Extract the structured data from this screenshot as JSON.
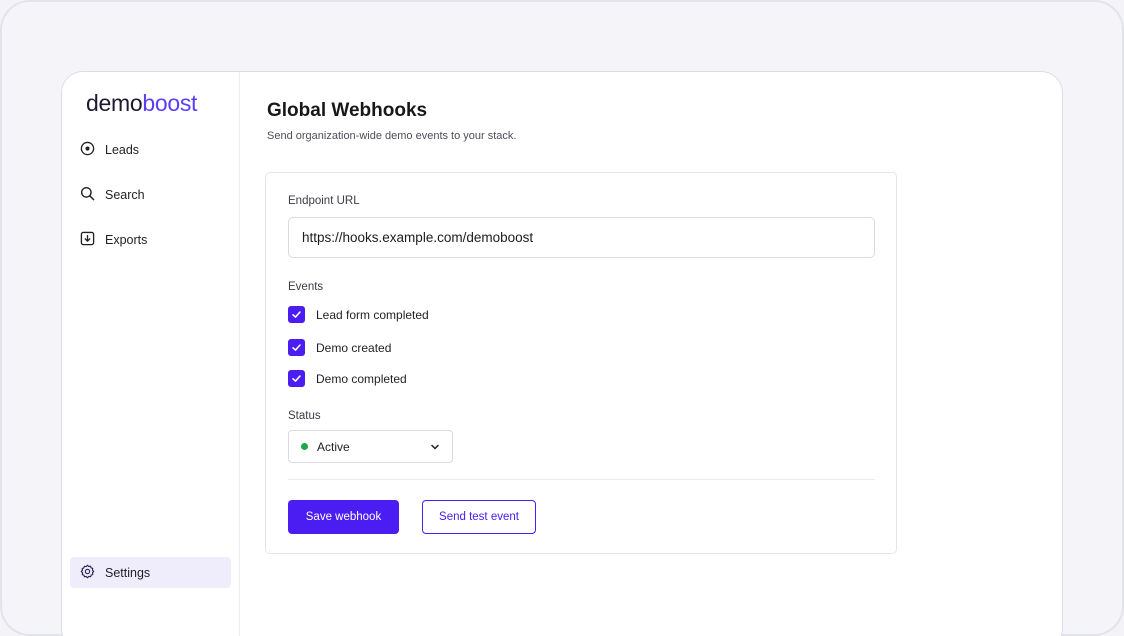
{
  "brand": {
    "logo_part1": "demo",
    "logo_part2": "boost",
    "accent": "#4b1df2"
  },
  "sidebar": {
    "items": [
      {
        "label": "Leads",
        "icon": "target-icon"
      },
      {
        "label": "Search",
        "icon": "search-icon"
      },
      {
        "label": "Exports",
        "icon": "download-icon"
      }
    ],
    "settings": {
      "label": "Settings",
      "icon": "gear-icon",
      "active": true
    }
  },
  "page": {
    "title": "Global Webhooks",
    "subtitle": "Send organization-wide demo events to your stack."
  },
  "form": {
    "endpoint_label": "Endpoint URL",
    "endpoint_value": "https://hooks.example.com/demoboost",
    "events_label": "Events",
    "events": [
      {
        "label": "Lead form completed",
        "checked": true
      },
      {
        "label": "Demo created",
        "checked": true
      },
      {
        "label": "Demo completed",
        "checked": true
      }
    ],
    "status_label": "Status",
    "status_value": "Active",
    "status_color": "#1fa64a"
  },
  "actions": {
    "save_label": "Save webhook",
    "test_label": "Send test event"
  }
}
